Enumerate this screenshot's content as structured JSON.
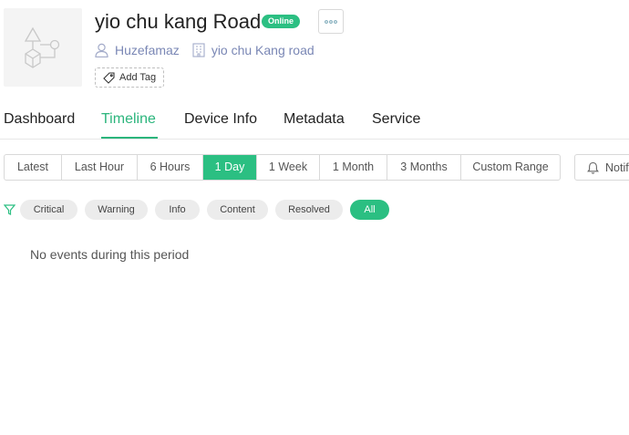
{
  "device": {
    "title": "yio chu kang Road",
    "status": "Online",
    "owner": "Huzefamaz",
    "location": "yio chu Kang road",
    "add_tag_label": "Add Tag",
    "thumbnail_icon": "shapes-placeholder-icon"
  },
  "tabs": [
    {
      "label": "Dashboard",
      "active": false
    },
    {
      "label": "Timeline",
      "active": true
    },
    {
      "label": "Device Info",
      "active": false
    },
    {
      "label": "Metadata",
      "active": false
    },
    {
      "label": "Service",
      "active": false
    }
  ],
  "time_ranges": [
    {
      "label": "Latest",
      "active": false
    },
    {
      "label": "Last Hour",
      "active": false
    },
    {
      "label": "6 Hours",
      "active": false
    },
    {
      "label": "1 Day",
      "active": true
    },
    {
      "label": "1 Week",
      "active": false
    },
    {
      "label": "1 Month",
      "active": false
    },
    {
      "label": "3 Months",
      "active": false
    },
    {
      "label": "Custom Range",
      "active": false
    }
  ],
  "notification_button": "Notif",
  "filters": [
    {
      "label": "Critical",
      "active": false
    },
    {
      "label": "Warning",
      "active": false
    },
    {
      "label": "Info",
      "active": false
    },
    {
      "label": "Content",
      "active": false
    },
    {
      "label": "Resolved",
      "active": false
    },
    {
      "label": "All",
      "active": true
    }
  ],
  "empty_message": "No events during this period",
  "colors": {
    "accent": "#2bbf82",
    "meta_text": "#7a87b5"
  }
}
